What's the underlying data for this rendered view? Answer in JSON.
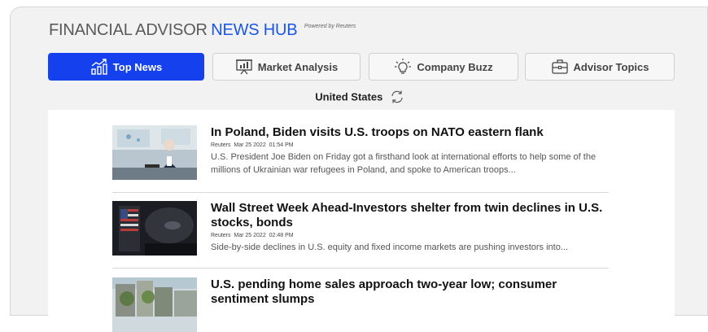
{
  "header": {
    "title_prefix": "FINANCIAL ADVISOR",
    "title_accent": "NEWS HUB",
    "powered_by": "Powered by Reuters"
  },
  "tabs": [
    {
      "label": "Top News",
      "icon": "chart-up-icon",
      "active": true
    },
    {
      "label": "Market Analysis",
      "icon": "presentation-chart-icon",
      "active": false
    },
    {
      "label": "Company Buzz",
      "icon": "lightbulb-icon",
      "active": false
    },
    {
      "label": "Advisor Topics",
      "icon": "briefcase-icon",
      "active": false
    }
  ],
  "region": {
    "label": "United States",
    "icon": "refresh-icon"
  },
  "articles": [
    {
      "headline": "In Poland, Biden visits U.S. troops on NATO eastern flank",
      "source": "Reuters",
      "date": "Mar 25 2022",
      "time": "01:54 PM",
      "summary": "U.S. President Joe Biden on Friday got a firsthand look at international efforts to help some of the millions of Ukrainian war refugees in Poland, and spoke to American troops..."
    },
    {
      "headline": "Wall Street Week Ahead-Investors shelter from twin declines in U.S. stocks, bonds",
      "source": "Reuters",
      "date": "Mar 25 2022",
      "time": "02:48 PM",
      "summary": "Side-by-side declines in U.S. equity and fixed income markets are pushing investors into..."
    },
    {
      "headline": "U.S. pending home sales approach two-year low; consumer sentiment slumps",
      "source": "",
      "date": "",
      "time": "",
      "summary": ""
    }
  ],
  "colors": {
    "accent": "#1440ee",
    "title_accent": "#1a56e8",
    "background": "#f2f2f2"
  }
}
